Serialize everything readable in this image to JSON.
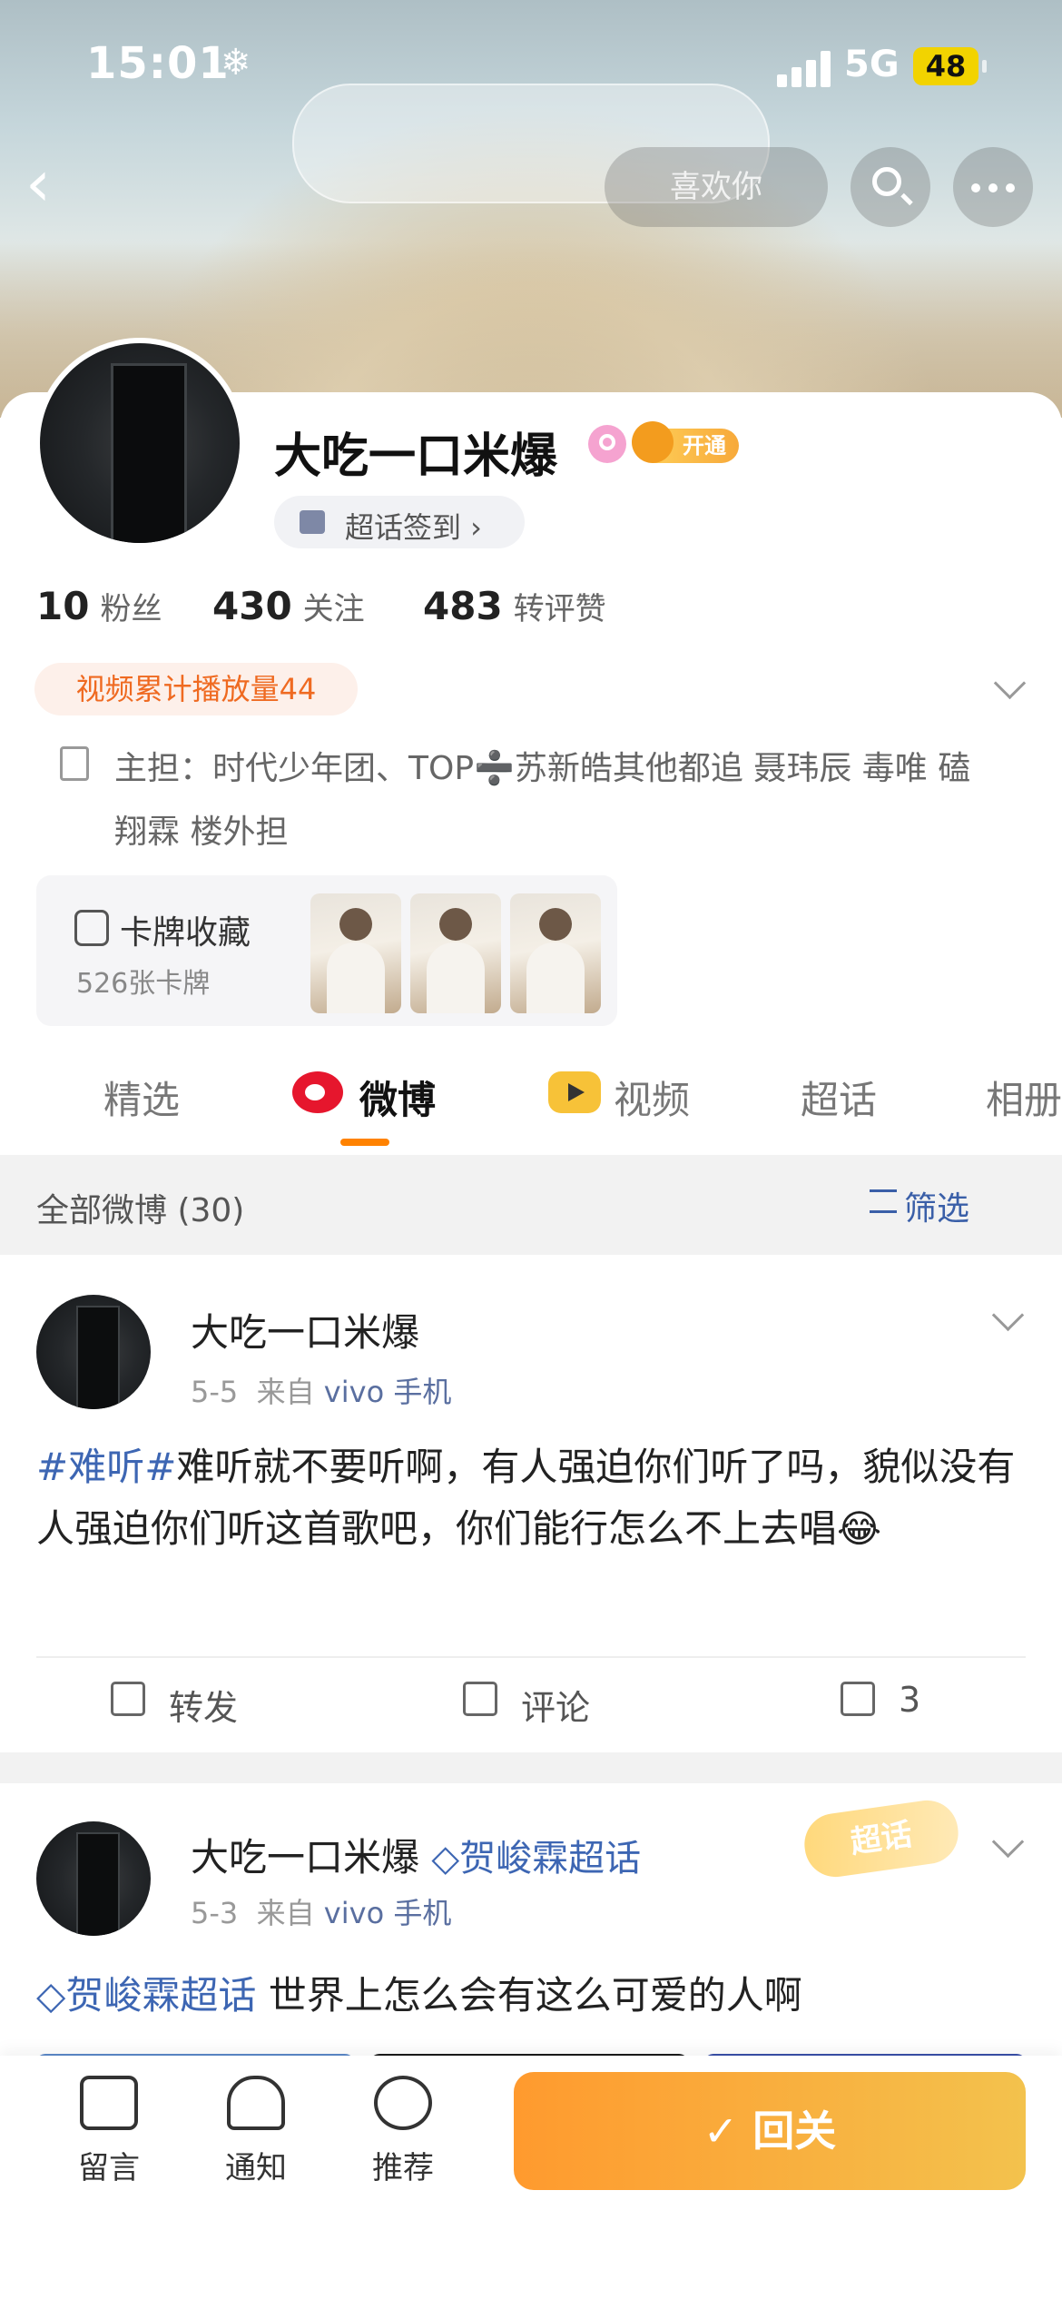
{
  "status_bar": {
    "time": "15:01",
    "network": "5G",
    "battery": "48"
  },
  "header": {
    "blurred_pill_hint": "喜欢你"
  },
  "profile": {
    "name": "大吃一口米爆",
    "vip_label": "开通",
    "checkin_label": "超话签到 ›",
    "stats": [
      {
        "value": "10",
        "label": "粉丝"
      },
      {
        "value": "430",
        "label": "关注"
      },
      {
        "value": "483",
        "label": "转评赞"
      }
    ],
    "play_count": "视频累计播放量44",
    "bio": "主担：时代少年团、TOP➗苏新皓其他都追 聂玮辰 毒唯  磕翔霖 楼外担",
    "cards": {
      "title": "卡牌收藏",
      "count": "526张卡牌"
    }
  },
  "tabs": [
    "精选",
    "微博",
    "视频",
    "超话",
    "相册"
  ],
  "active_tab": "微博",
  "filter": {
    "count": "全部微博 (30)",
    "button": "筛选"
  },
  "posts": [
    {
      "author": "大吃一口米爆",
      "date": "5-5",
      "source_prefix": "来自",
      "source": "vivo 手机",
      "topic": "#难听#",
      "text": "难听就不要听啊，有人强迫你们听了吗，貌似没有人强迫你们听这首歌吧，你们能行怎么不上去唱😂",
      "actions": {
        "repost": "转发",
        "comment": "评论",
        "like": "3"
      }
    },
    {
      "author": "大吃一口米爆",
      "tag": "贺峻霖超话",
      "date": "5-3",
      "source_prefix": "来自",
      "source": "vivo 手机",
      "sticker": "超话",
      "topic": "贺峻霖超话",
      "text": "世界上怎么会有这么可爱的人啊"
    }
  ],
  "bottom_bar": {
    "items": [
      "留言",
      "通知",
      "推荐"
    ],
    "unfollow": "✓ 回关"
  },
  "colors": {
    "accent": "#ff8200",
    "weibo_red": "#e6162d",
    "link_blue": "#3d66b3",
    "unfollow_start": "#ff9a2e",
    "unfollow_end": "#f3c24d"
  }
}
